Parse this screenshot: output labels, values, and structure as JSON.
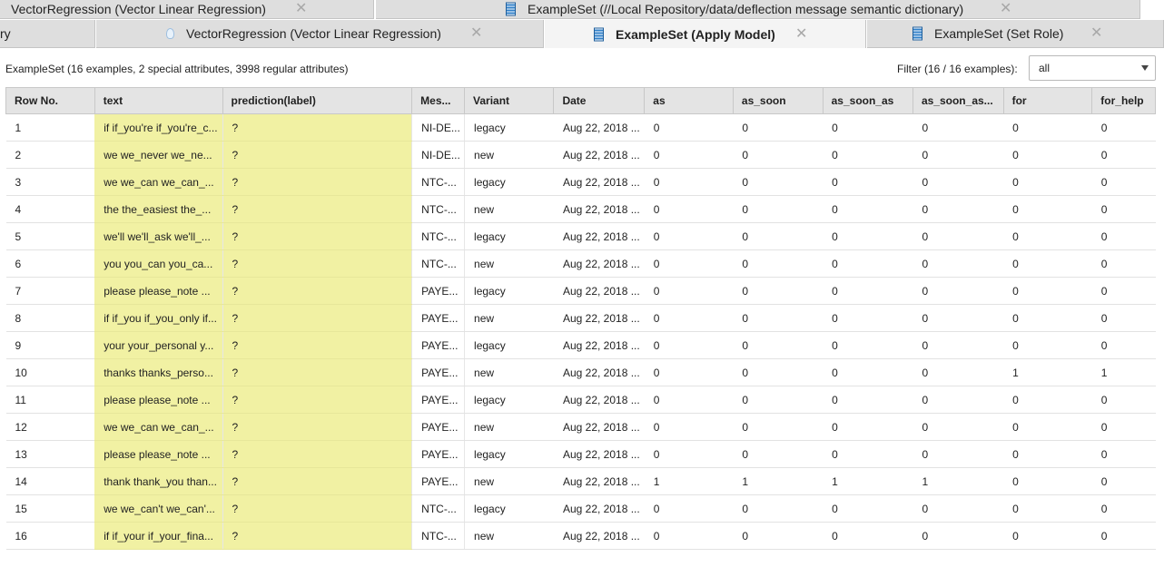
{
  "tabs_row1": [
    {
      "label": "VectorRegression (Vector Linear Regression)",
      "icon": "none"
    },
    {
      "label": "ExampleSet (//Local Repository/data/deflection message semantic dictionary)",
      "icon": "table-icon"
    }
  ],
  "tabs_row2": [
    {
      "label": "ry"
    },
    {
      "label": "VectorRegression (Vector Linear Regression)",
      "icon": "lightbulb-icon"
    },
    {
      "label": "ExampleSet (Apply Model)",
      "icon": "table-icon",
      "active": true
    },
    {
      "label": "ExampleSet (Set Role)",
      "icon": "table-icon"
    }
  ],
  "info": {
    "summary": "ExampleSet (16 examples, 2 special attributes, 3998 regular attributes)",
    "filter_label": "Filter (16 / 16 examples):",
    "filter_value": "all"
  },
  "colors": {
    "special_column": "#f1f1a3",
    "header_bg": "#e4e4e4",
    "active_tab": "#f4f4f4"
  },
  "table": {
    "columns": [
      "Row No.",
      "text",
      "prediction(label)",
      "Mes...",
      "Variant",
      "Date",
      "as",
      "as_soon",
      "as_soon_as",
      "as_soon_as...",
      "for",
      "for_help"
    ],
    "rows": [
      [
        "1",
        "if if_you're if_you're_c...",
        "?",
        "NI-DE...",
        "legacy",
        "Aug 22, 2018 ...",
        "0",
        "0",
        "0",
        "0",
        "0",
        "0"
      ],
      [
        "2",
        "we we_never we_ne...",
        "?",
        "NI-DE...",
        "new",
        "Aug 22, 2018 ...",
        "0",
        "0",
        "0",
        "0",
        "0",
        "0"
      ],
      [
        "3",
        "we we_can we_can_...",
        "?",
        "NTC-...",
        "legacy",
        "Aug 22, 2018 ...",
        "0",
        "0",
        "0",
        "0",
        "0",
        "0"
      ],
      [
        "4",
        "the the_easiest the_...",
        "?",
        "NTC-...",
        "new",
        "Aug 22, 2018 ...",
        "0",
        "0",
        "0",
        "0",
        "0",
        "0"
      ],
      [
        "5",
        "we'll we'll_ask we'll_...",
        "?",
        "NTC-...",
        "legacy",
        "Aug 22, 2018 ...",
        "0",
        "0",
        "0",
        "0",
        "0",
        "0"
      ],
      [
        "6",
        "you you_can you_ca...",
        "?",
        "NTC-...",
        "new",
        "Aug 22, 2018 ...",
        "0",
        "0",
        "0",
        "0",
        "0",
        "0"
      ],
      [
        "7",
        "please please_note ...",
        "?",
        "PAYE...",
        "legacy",
        "Aug 22, 2018 ...",
        "0",
        "0",
        "0",
        "0",
        "0",
        "0"
      ],
      [
        "8",
        "if if_you if_you_only if...",
        "?",
        "PAYE...",
        "new",
        "Aug 22, 2018 ...",
        "0",
        "0",
        "0",
        "0",
        "0",
        "0"
      ],
      [
        "9",
        "your your_personal y...",
        "?",
        "PAYE...",
        "legacy",
        "Aug 22, 2018 ...",
        "0",
        "0",
        "0",
        "0",
        "0",
        "0"
      ],
      [
        "10",
        "thanks thanks_perso...",
        "?",
        "PAYE...",
        "new",
        "Aug 22, 2018 ...",
        "0",
        "0",
        "0",
        "0",
        "1",
        "1"
      ],
      [
        "11",
        "please please_note ...",
        "?",
        "PAYE...",
        "legacy",
        "Aug 22, 2018 ...",
        "0",
        "0",
        "0",
        "0",
        "0",
        "0"
      ],
      [
        "12",
        "we we_can we_can_...",
        "?",
        "PAYE...",
        "new",
        "Aug 22, 2018 ...",
        "0",
        "0",
        "0",
        "0",
        "0",
        "0"
      ],
      [
        "13",
        "please please_note ...",
        "?",
        "PAYE...",
        "legacy",
        "Aug 22, 2018 ...",
        "0",
        "0",
        "0",
        "0",
        "0",
        "0"
      ],
      [
        "14",
        "thank thank_you than...",
        "?",
        "PAYE...",
        "new",
        "Aug 22, 2018 ...",
        "1",
        "1",
        "1",
        "1",
        "0",
        "0"
      ],
      [
        "15",
        "we we_can't we_can'...",
        "?",
        "NTC-...",
        "legacy",
        "Aug 22, 2018 ...",
        "0",
        "0",
        "0",
        "0",
        "0",
        "0"
      ],
      [
        "16",
        "if if_your if_your_fina...",
        "?",
        "NTC-...",
        "new",
        "Aug 22, 2018 ...",
        "0",
        "0",
        "0",
        "0",
        "0",
        "0"
      ]
    ]
  }
}
